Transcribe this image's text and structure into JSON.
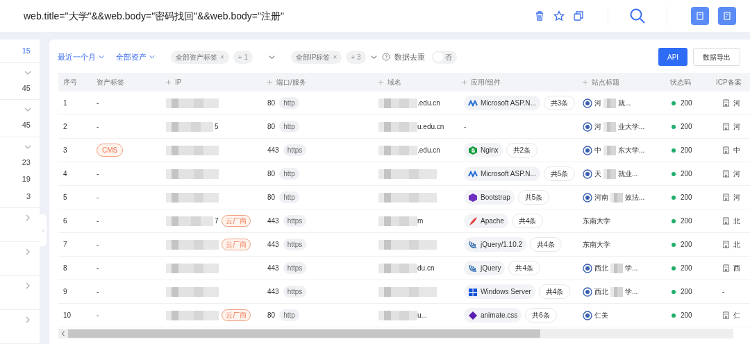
{
  "search": {
    "query": "web.title=\"大学\"&&web.body=\"密码找回\"&&web.body=\"注册\""
  },
  "sidebar": {
    "sections": [
      {
        "kind": "link",
        "counts": [
          "15"
        ]
      },
      {
        "kind": "group",
        "expanded": true,
        "counts": [
          "45"
        ]
      },
      {
        "kind": "group",
        "expanded": true,
        "counts": [
          "45"
        ]
      },
      {
        "kind": "group",
        "expanded": true,
        "counts": [
          "23",
          "19",
          "3"
        ]
      },
      {
        "kind": "group",
        "expanded": false
      },
      {
        "kind": "group",
        "expanded": false
      },
      {
        "kind": "group",
        "expanded": false
      },
      {
        "kind": "group",
        "expanded": false
      }
    ]
  },
  "filters": {
    "time": "最近一个月",
    "assets": "全部资产",
    "asset_tag": {
      "label": "全部资产标签",
      "remove": "×",
      "more": "+ 1"
    },
    "ip_tag": {
      "label": "全部IP标签",
      "remove": "×",
      "more": "+ 3"
    },
    "dedupe": {
      "label": "数据去重",
      "on": false,
      "state_text": "否"
    }
  },
  "actions": [
    "API",
    "数据导出"
  ],
  "table": {
    "columns": [
      "序号",
      "资产标签",
      "IP",
      "端口/服务",
      "域名",
      "应用/组件",
      "站点标题",
      "状态码",
      "ICP备案"
    ],
    "rows": [
      {
        "index": "1",
        "tag": "-",
        "cloud": false,
        "port": "80",
        "service": "http",
        "domain": ".edu.cn",
        "app": {
          "kind": "wave",
          "name": "Microsoft ASP.N...",
          "count": "共3条"
        },
        "title": {
          "kind": "emblem",
          "head": "河",
          "tail": "就..."
        },
        "status": "200",
        "icp": "河"
      },
      {
        "index": "2",
        "tag": "-",
        "ip_suffix": "5",
        "cloud": false,
        "port": "80",
        "service": "http",
        "domain": "u.edu.cn",
        "app": {
          "kind": "text",
          "name": "-"
        },
        "title": {
          "kind": "emblem",
          "head": "河",
          "tail": "业大学..."
        },
        "status": "200",
        "icp": "河"
      },
      {
        "index": "3",
        "tag": "CMS",
        "cloud": false,
        "port": "443",
        "service": "https",
        "domain": ".edu.cn",
        "app": {
          "kind": "g",
          "name": "Nginx",
          "count": "共2条"
        },
        "title": {
          "kind": "emblem",
          "head": "中",
          "tail": "东大学..."
        },
        "status": "200",
        "icp": "中"
      },
      {
        "index": "4",
        "tag": "-",
        "cloud": false,
        "port": "80",
        "service": "http",
        "app": {
          "kind": "wave",
          "name": "Microsoft ASP.N...",
          "count": "共5条"
        },
        "title": {
          "kind": "emblem",
          "head": "天",
          "tail": "就业..."
        },
        "status": "200",
        "icp": "河"
      },
      {
        "index": "5",
        "tag": "-",
        "cloud": false,
        "port": "80",
        "service": "http",
        "app": {
          "kind": "hexagon",
          "name": "Bootstrap",
          "count": "共5条"
        },
        "title": {
          "kind": "emblem",
          "head": "河南",
          "tail": "效法..."
        },
        "status": "200",
        "icp": "河"
      },
      {
        "index": "6",
        "tag": "-",
        "ip_suffix": "7",
        "cloud": true,
        "cloud_label": "云厂商",
        "port": "443",
        "service": "https",
        "domain": "m",
        "app": {
          "kind": "feather",
          "name": "Apache",
          "count": "共4条"
        },
        "title": {
          "kind": "plain",
          "head": "东南大学"
        },
        "status": "200",
        "icp": "北"
      },
      {
        "index": "7",
        "tag": "-",
        "cloud": true,
        "cloud_label": "云厂商",
        "port": "443",
        "service": "https",
        "app": {
          "kind": "swirl",
          "name": "jQuery/1.10.2",
          "count": "共4条"
        },
        "title": {
          "kind": "plain",
          "head": "东南大学"
        },
        "status": "200",
        "icp": "北"
      },
      {
        "index": "8",
        "tag": "-",
        "cloud": false,
        "port": "443",
        "service": "https",
        "domain": "du.cn",
        "app": {
          "kind": "swirl",
          "name": "jQuery",
          "count": "共4条"
        },
        "title": {
          "kind": "emblem",
          "head": "西北",
          "tail": "学..."
        },
        "status": "200",
        "icp": "西"
      },
      {
        "index": "9",
        "tag": "-",
        "cloud": false,
        "port": "443",
        "service": "https",
        "app": {
          "kind": "windows",
          "name": "Windows Server",
          "count": "共4条"
        },
        "title": {
          "kind": "emblem",
          "head": "西北",
          "tail": "学..."
        },
        "status": "200",
        "icp": "-"
      },
      {
        "index": "10",
        "tag": "-",
        "cloud": true,
        "cloud_label": "云厂商",
        "port": "80",
        "service": "http",
        "domain": "u...",
        "app": {
          "kind": "diamond",
          "name": "animate.css",
          "count": "共6条"
        },
        "title": {
          "kind": "emblem",
          "head": "仁美"
        },
        "status": "200",
        "icp": "仁"
      }
    ]
  }
}
